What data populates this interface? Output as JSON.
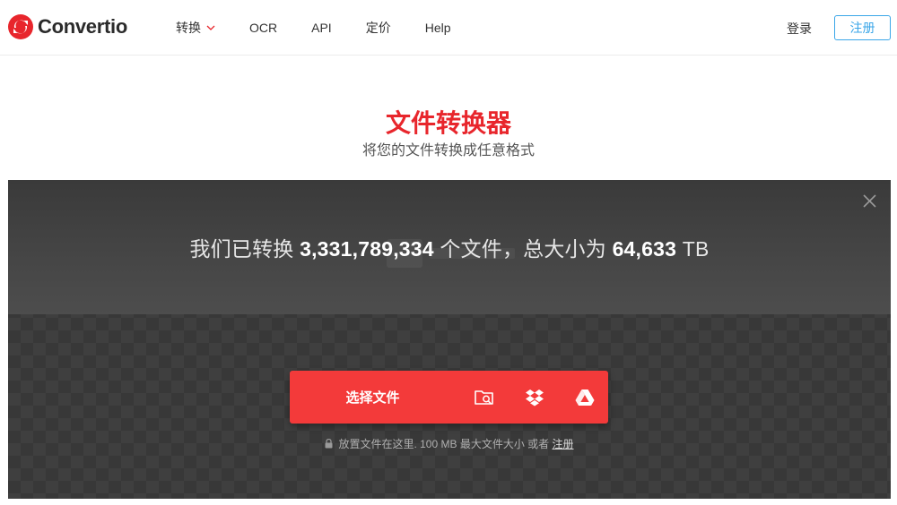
{
  "brand": {
    "name": "Convertio",
    "color": "#e8262c"
  },
  "nav": {
    "items": [
      {
        "label": "转换",
        "has_dropdown": true
      },
      {
        "label": "OCR"
      },
      {
        "label": "API"
      },
      {
        "label": "定价"
      },
      {
        "label": "Help"
      }
    ],
    "login": "登录",
    "signup": "注册"
  },
  "hero": {
    "title": "文件转换器",
    "subtitle": "将您的文件转换成任意格式"
  },
  "stats": {
    "prefix": "我们已转换",
    "files_count": "3,331,789,334",
    "middle": "个文件，总大小为",
    "total_size": "64,633",
    "unit": "TB"
  },
  "upload": {
    "choose_label": "选择文件",
    "sources": [
      "folder-search-icon",
      "dropbox-icon",
      "google-drive-icon"
    ],
    "hint_text": "放置文件在这里. 100 MB 最大文件大小 或者",
    "hint_link": "注册"
  },
  "colors": {
    "accent": "#f33a3a",
    "signup_border": "#3aa6e8"
  }
}
